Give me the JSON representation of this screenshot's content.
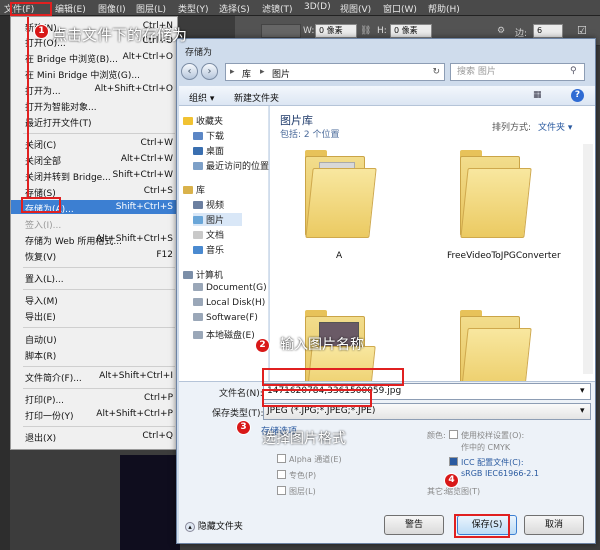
{
  "menubar": [
    "文件(F)",
    "编辑(E)",
    "图像(I)",
    "图层(L)",
    "类型(Y)",
    "选择(S)",
    "滤镜(T)",
    "3D(D)",
    "视图(V)",
    "窗口(W)",
    "帮助(H)"
  ],
  "toolbar": {
    "w_label": "W:",
    "w_value": "0 像素",
    "h_label": "H:",
    "h_value": "0 像素",
    "edges_label": "边:",
    "edges_value": "6"
  },
  "file_menu": [
    {
      "label": "新建(N)...",
      "shortcut": "Ctrl+N"
    },
    {
      "label": "打开(O)...",
      "shortcut": "Ctrl+O"
    },
    {
      "label": "在 Bridge 中浏览(B)...",
      "shortcut": "Alt+Ctrl+O"
    },
    {
      "label": "在 Mini Bridge 中浏览(G)...",
      "shortcut": ""
    },
    {
      "label": "打开为...",
      "shortcut": "Alt+Shift+Ctrl+O"
    },
    {
      "label": "打开为智能对象...",
      "shortcut": ""
    },
    {
      "label": "最近打开文件(T)",
      "shortcut": ""
    },
    {
      "label": "关闭(C)",
      "shortcut": "Ctrl+W"
    },
    {
      "label": "关闭全部",
      "shortcut": "Alt+Ctrl+W"
    },
    {
      "label": "关闭并转到 Bridge...",
      "shortcut": "Shift+Ctrl+W"
    },
    {
      "label": "存储(S)",
      "shortcut": "Ctrl+S"
    },
    {
      "label": "存储为(A)...",
      "shortcut": "Shift+Ctrl+S"
    },
    {
      "label": "签入(I)...",
      "shortcut": ""
    },
    {
      "label": "存储为 Web 所用格式...",
      "shortcut": "Alt+Shift+Ctrl+S"
    },
    {
      "label": "恢复(V)",
      "shortcut": "F12"
    },
    {
      "label": "置入(L)...",
      "shortcut": ""
    },
    {
      "label": "导入(M)",
      "shortcut": ""
    },
    {
      "label": "导出(E)",
      "shortcut": ""
    },
    {
      "label": "自动(U)",
      "shortcut": ""
    },
    {
      "label": "脚本(R)",
      "shortcut": ""
    },
    {
      "label": "文件简介(F)...",
      "shortcut": "Alt+Shift+Ctrl+I"
    },
    {
      "label": "打印(P)...",
      "shortcut": "Ctrl+P"
    },
    {
      "label": "打印一份(Y)",
      "shortcut": "Alt+Shift+Ctrl+P"
    },
    {
      "label": "退出(X)",
      "shortcut": "Ctrl+Q"
    }
  ],
  "dialog": {
    "title": "存储为",
    "breadcrumb": [
      "库",
      "图片"
    ],
    "search_placeholder": "搜索 图片",
    "organize": "组织 ▾",
    "new_folder": "新建文件夹",
    "library_title": "图片库",
    "library_sub": "包括: 2 个位置",
    "sort_label": "排列方式:",
    "sort_value": "文件夹 ▾",
    "nav": [
      "收藏夹",
      "下载",
      "桌面",
      "最近访问的位置",
      "库",
      "视频",
      "图片",
      "文档",
      "音乐",
      "计算机",
      "Document(G)",
      "Local Disk(H)",
      "Software(F)",
      "本地磁盘(E)"
    ],
    "folders": [
      "A",
      "FreeVideoToJPGConverter"
    ],
    "filename_label": "文件名(N):",
    "filename_value": "1471620784,3361500059.jpg",
    "filetype_label": "保存类型(T):",
    "filetype_value": "JPEG (*.JPG;*.JPEG;*.JPE)",
    "save_options": "存储选项",
    "options": [
      "Alpha 通道(E)",
      "专色(P)",
      "图层(L)"
    ],
    "color_label": "颜色:",
    "proof": "使用校样设置(O):",
    "proof_sub": "作中的 CMYK",
    "icc": "ICC 配置文件(C):",
    "icc_value": "sRGB IEC61966-2.1",
    "other": "其它:",
    "other_sub": "缩览图(T)",
    "warning_btn": "警告",
    "save_btn": "保存(S)",
    "cancel_btn": "取消",
    "hide_folders": "隐藏文件夹"
  },
  "annotations": [
    {
      "num": "1",
      "text": "点击文件下的存储为"
    },
    {
      "num": "2",
      "text": "输入图片名称"
    },
    {
      "num": "3",
      "text": "选择图片格式"
    },
    {
      "num": "4",
      "text": ""
    }
  ],
  "colors": {
    "annotation_red": "#e02020",
    "highlight_blue": "#3c7fd2"
  }
}
